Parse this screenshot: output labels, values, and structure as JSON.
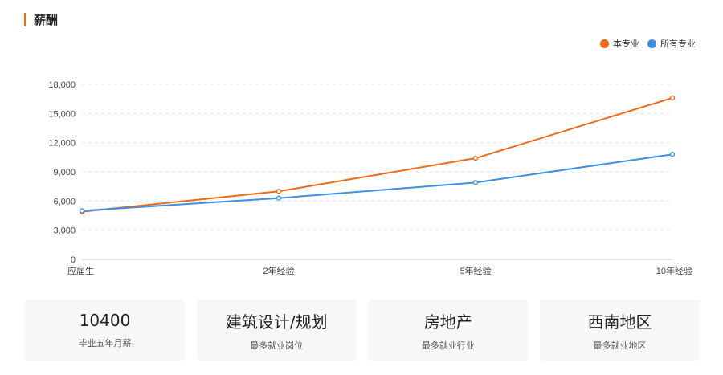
{
  "section": {
    "title": "薪酬"
  },
  "colors": {
    "accent": "#ee6a18",
    "series_major": "#ee6a18",
    "series_all": "#3c8fe6"
  },
  "chart_data": {
    "type": "line",
    "categories": [
      "应届生",
      "2年经验",
      "5年经验",
      "10年经验"
    ],
    "series": [
      {
        "name": "本专业",
        "color": "#ee6a18",
        "values": [
          4900,
          7000,
          10400,
          16600
        ]
      },
      {
        "name": "所有专业",
        "color": "#3c8fe6",
        "values": [
          5000,
          6300,
          7900,
          10800
        ]
      }
    ],
    "ylim": [
      0,
      18000
    ],
    "yticks": [
      0,
      3000,
      6000,
      9000,
      12000,
      15000,
      18000
    ],
    "ytick_labels": [
      "0",
      "3,000",
      "6,000",
      "9,000",
      "12,000",
      "15,000",
      "18,000"
    ],
    "grid": true,
    "legend_position": "top-right"
  },
  "cards": [
    {
      "value": "10400",
      "label": "毕业五年月薪"
    },
    {
      "value": "建筑设计/规划",
      "label": "最多就业岗位"
    },
    {
      "value": "房地产",
      "label": "最多就业行业"
    },
    {
      "value": "西南地区",
      "label": "最多就业地区"
    }
  ]
}
